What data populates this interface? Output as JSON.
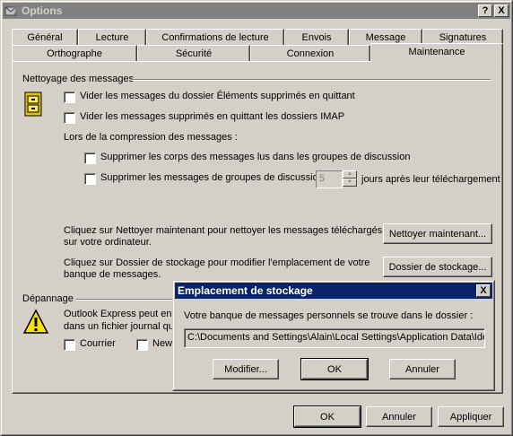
{
  "window": {
    "title": "Options",
    "help_btn": "?",
    "close_btn": "X"
  },
  "tabs_back": [
    "Général",
    "Lecture",
    "Confirmations de lecture",
    "Envois",
    "Message",
    "Signatures"
  ],
  "tabs_front": [
    "Orthographe",
    "Sécurité",
    "Connexion",
    "Maintenance"
  ],
  "cleanup": {
    "heading": "Nettoyage des messages",
    "chk1_label": "Vider les messages du dossier Éléments supprimés en quittant",
    "chk2_label": "Vider les messages supprimés en quittant les dossiers IMAP",
    "compress_label": "Lors de la compression des messages :",
    "chk3_label": "Supprimer les corps des messages lus dans les groupes de discussion",
    "chk4_label": "Supprimer les messages de groupes de discussion",
    "days_value": "5",
    "days_suffix": "jours après leur téléchargement",
    "clean_text_1": "Cliquez sur Nettoyer maintenant pour nettoyer les messages téléchargés",
    "clean_text_2": "sur votre ordinateur.",
    "clean_button": "Nettoyer maintenant...",
    "store_text_1": "Cliquez sur Dossier de stockage pour modifier l'emplacement de votre",
    "store_text_2": "banque de messages.",
    "store_button": "Dossier de stockage..."
  },
  "troubleshoot": {
    "heading": "Dépannage",
    "text_1": "Outlook Express peut enre",
    "text_2": "dans un fichier journal qu",
    "chk_mail": "Courrier",
    "chk_news": "News"
  },
  "footer": {
    "ok": "OK",
    "cancel": "Annuler",
    "apply": "Appliquer"
  },
  "storage_dialog": {
    "title": "Emplacement de stockage",
    "close_btn": "X",
    "label": "Votre banque de messages personnels se trouve dans le dossier :",
    "path": "C:\\Documents and Settings\\Alain\\Local Settings\\Application Data\\Identities\\{",
    "modify": "Modifier...",
    "ok": "OK",
    "cancel": "Annuler"
  }
}
